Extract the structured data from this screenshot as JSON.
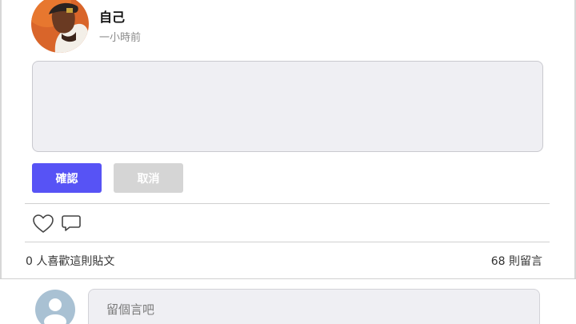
{
  "post": {
    "author_name": "自己",
    "time": "一小時前"
  },
  "editor": {
    "value": "",
    "confirm_label": "確認",
    "cancel_label": "取消"
  },
  "actions": {
    "like_icon": "heart-outline-icon",
    "comment_icon": "speech-bubble-icon"
  },
  "stats": {
    "likes_text": "0 人喜歡這則貼文",
    "comments_text": "68 則留言"
  },
  "comment_box": {
    "placeholder": "留個言吧"
  },
  "colors": {
    "primary": "#5753f5",
    "disabled": "#d5d5d5",
    "input_bg": "#efeff3",
    "muted_text": "#8a8a8a"
  }
}
